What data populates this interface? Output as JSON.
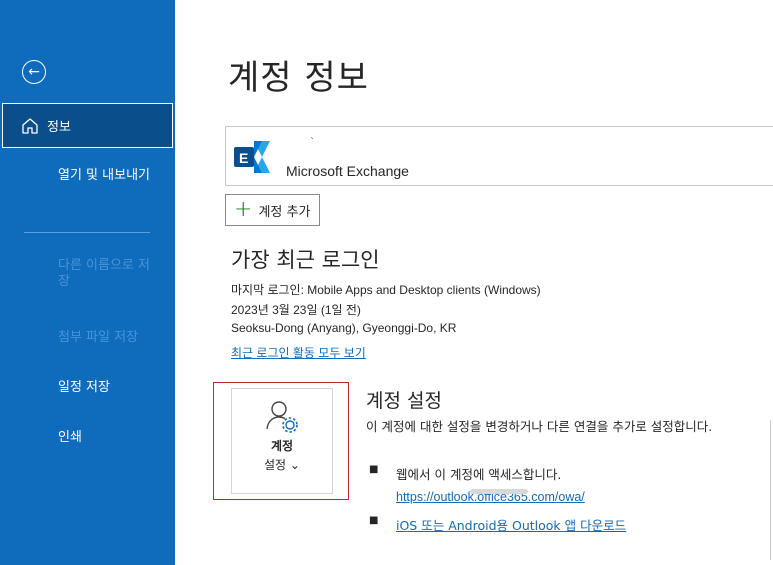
{
  "sidebar": {
    "back_icon": "arrow-left-circle-icon",
    "items": [
      {
        "label": "정보",
        "icon": "home-icon",
        "selected": true
      },
      {
        "label": "열기 및 내보내기"
      },
      {
        "label": "다른 이름으로 저장",
        "disabled": true
      },
      {
        "label": "첨부 파일 저장",
        "disabled": true
      },
      {
        "label": "일정 저장"
      },
      {
        "label": "인쇄"
      }
    ]
  },
  "main": {
    "title": "계정 정보",
    "account": {
      "sub": "`",
      "name": "Microsoft Exchange",
      "logo": "exchange-logo-icon"
    },
    "add_account": "계정 추가",
    "recent": {
      "title": "가장 최근 로그인",
      "last_login": "마지막 로그인: Mobile Apps and Desktop clients (Windows)",
      "date": "2023년 3월 23일 (1일 전)",
      "location": "Seoksu-Dong (Anyang), Gyeonggi-Do, KR",
      "view_all": "최근 로그인 활동 모두 보기"
    },
    "settings_button": {
      "line1": "계정",
      "line2": "설정 ⌄"
    },
    "settings": {
      "title": "계정 설정",
      "desc": "이 계정에 대한 설정을 변경하거나 다른 연결을 추가로 설정합니다.",
      "bullet1": "웹에서 이 계정에 액세스합니다.",
      "url": "https://outlook.office365.com/owa/",
      "bullet2": "iOS 또는 Android용 Outlook 앱 다운로드"
    }
  },
  "colors": {
    "sidebar_bg": "#0f6cbd",
    "selected_bg": "#0a4f8c",
    "link": "#0f6cbd",
    "highlight_border": "#c0282a"
  }
}
